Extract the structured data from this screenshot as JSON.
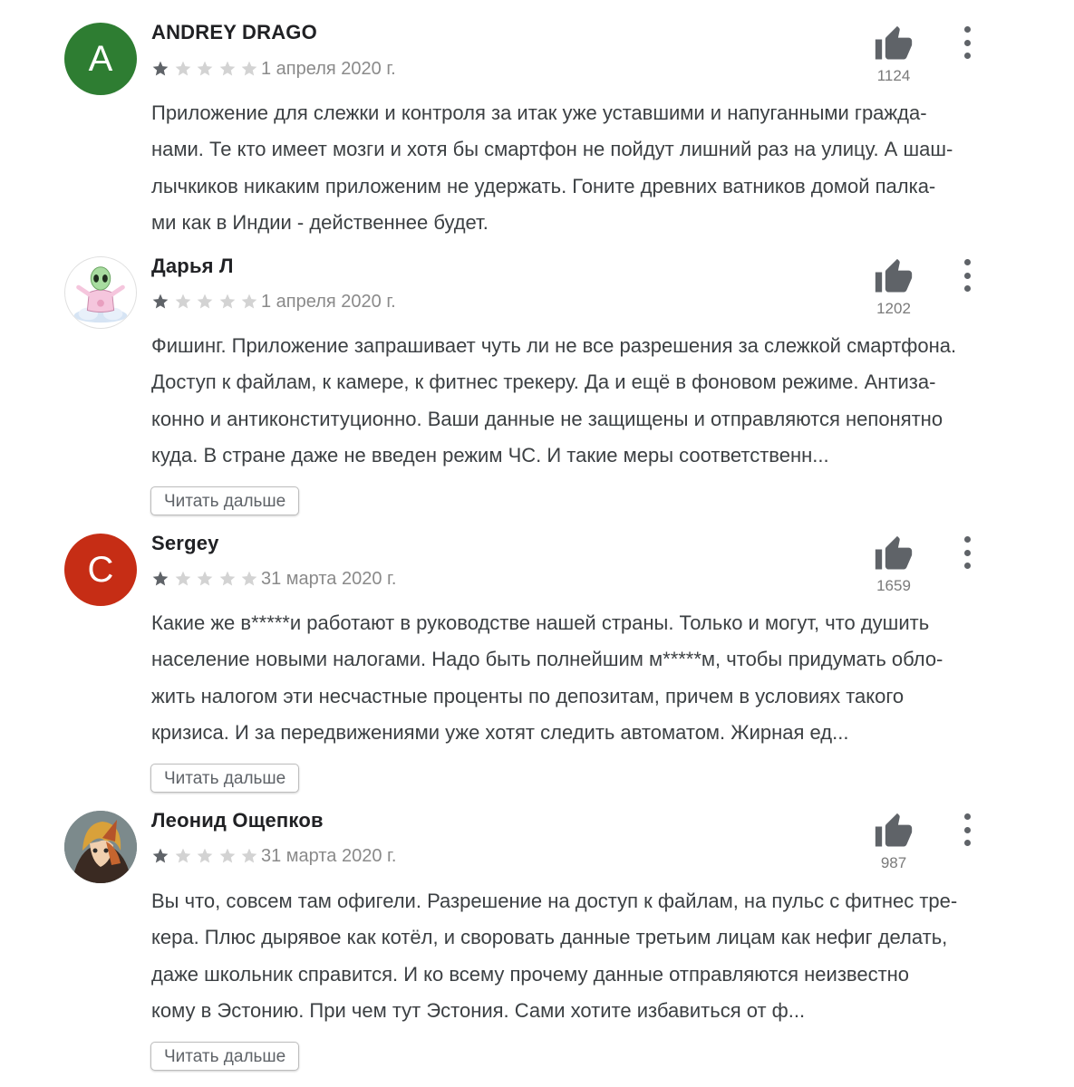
{
  "colors": {
    "star_filled": "#5f6368",
    "star_empty": "#d3d3d3",
    "avatar_green": "#2e7d32",
    "avatar_red": "#c62d15",
    "icon_gray": "#5f6368"
  },
  "icons": {
    "like": "thumb-up-icon",
    "more": "more-vert-icon",
    "star": "star-icon"
  },
  "reviews": [
    {
      "name": "ANDREY DRAGO",
      "avatar_letter": "A",
      "rating": 1,
      "date": "1 апреля 2020 г.",
      "likes": "1124",
      "lines": [
        "Приложение для слежки и контроля за итак уже уставшими и напуганными гражда-",
        "нами. Те кто имеет мозги и хотя бы смартфон не пойдут лишний раз на улицу. А шаш-",
        "лычкиков никаким приложеним не удержать. Гоните древних ватников домой палка-",
        "ми как в Индии - действеннее будет."
      ]
    },
    {
      "name": "Дарья Л",
      "avatar_letter": "",
      "rating": 1,
      "date": "1 апреля 2020 г.",
      "likes": "1202",
      "lines": [
        "Фишинг. Приложение запрашивает чуть ли не все разрешения за слежкой смартфона.",
        "Доступ к файлам, к камере, к фитнес трекеру. Да и ещё в фоновом режиме. Антиза-",
        "конно и антиконституционно. Ваши данные не защищены и отправляются непонятно",
        "куда. В стране даже не введен режим ЧС. И такие меры соответственн..."
      ],
      "read_more": "Читать дальше"
    },
    {
      "name": "Sergey",
      "avatar_letter": "C",
      "rating": 1,
      "date": "31 марта 2020 г.",
      "likes": "1659",
      "lines": [
        "Какие же в*****и работают в руководстве нашей страны. Только и могут, что душить",
        "население новыми налогами. Надо быть полнейшим м*****м, чтобы придумать обло-",
        "жить налогом эти несчастные проценты по депозитам, причем в условиях такого",
        "кризиса. И за передвижениями уже хотят следить автоматом. Жирная ед..."
      ],
      "read_more": "Читать дальше"
    },
    {
      "name": "Леонид Ощепков",
      "avatar_letter": "",
      "rating": 1,
      "date": "31 марта 2020 г.",
      "likes": "987",
      "lines": [
        "Вы что, совсем там офигели. Разрешение на доступ к файлам, на пульс с фитнес тре-",
        "кера. Плюс дырявое как котёл, и своровать данные третьим лицам как нефиг делать,",
        "даже школьник справится. И ко всему прочему данные отправляются неизвестно",
        "кому в Эстонию. При чем тут Эстония. Сами хотите избавиться от ф..."
      ],
      "read_more": "Читать дальше"
    }
  ]
}
